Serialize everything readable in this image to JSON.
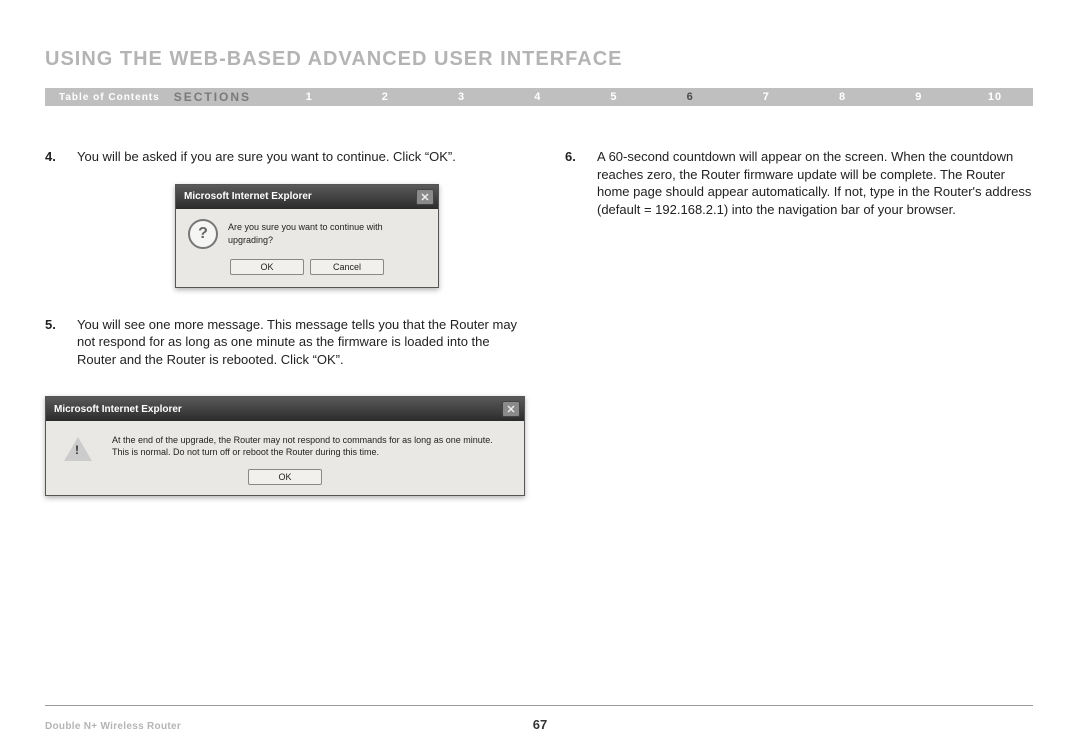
{
  "header": {
    "title": "USING THE WEB-BASED ADVANCED USER INTERFACE"
  },
  "nav": {
    "toc_label": "Table of Contents",
    "sections_label": "SECTIONS",
    "items": [
      "1",
      "2",
      "3",
      "4",
      "5",
      "6",
      "7",
      "8",
      "9",
      "10"
    ],
    "active_index": 5
  },
  "left_col": {
    "steps": [
      {
        "num": "4.",
        "text": "You will be asked if you are sure you want to continue. Click “OK”."
      },
      {
        "num": "5.",
        "text": "You will see one more message. This message tells you that the Router may not respond for as long as one minute as the firmware is loaded into the Router and the Router is rebooted. Click “OK”."
      }
    ]
  },
  "right_col": {
    "steps": [
      {
        "num": "6.",
        "text": "A 60-second countdown will appear on the screen. When the countdown reaches zero, the Router firmware update will be complete. The Router home page should appear automatically. If not, type in the Router's address (default = 192.168.2.1) into the navigation bar of your browser."
      }
    ]
  },
  "dialog1": {
    "title": "Microsoft Internet Explorer",
    "message": "Are you sure you want to continue with upgrading?",
    "ok_label": "OK",
    "cancel_label": "Cancel"
  },
  "dialog2": {
    "title": "Microsoft Internet Explorer",
    "message": "At the end of the upgrade, the Router may not respond to commands for as long as one minute. This is normal. Do not turn off or reboot the Router during this time.",
    "ok_label": "OK"
  },
  "footer": {
    "product": "Double N+ Wireless Router",
    "page_number": "67"
  }
}
